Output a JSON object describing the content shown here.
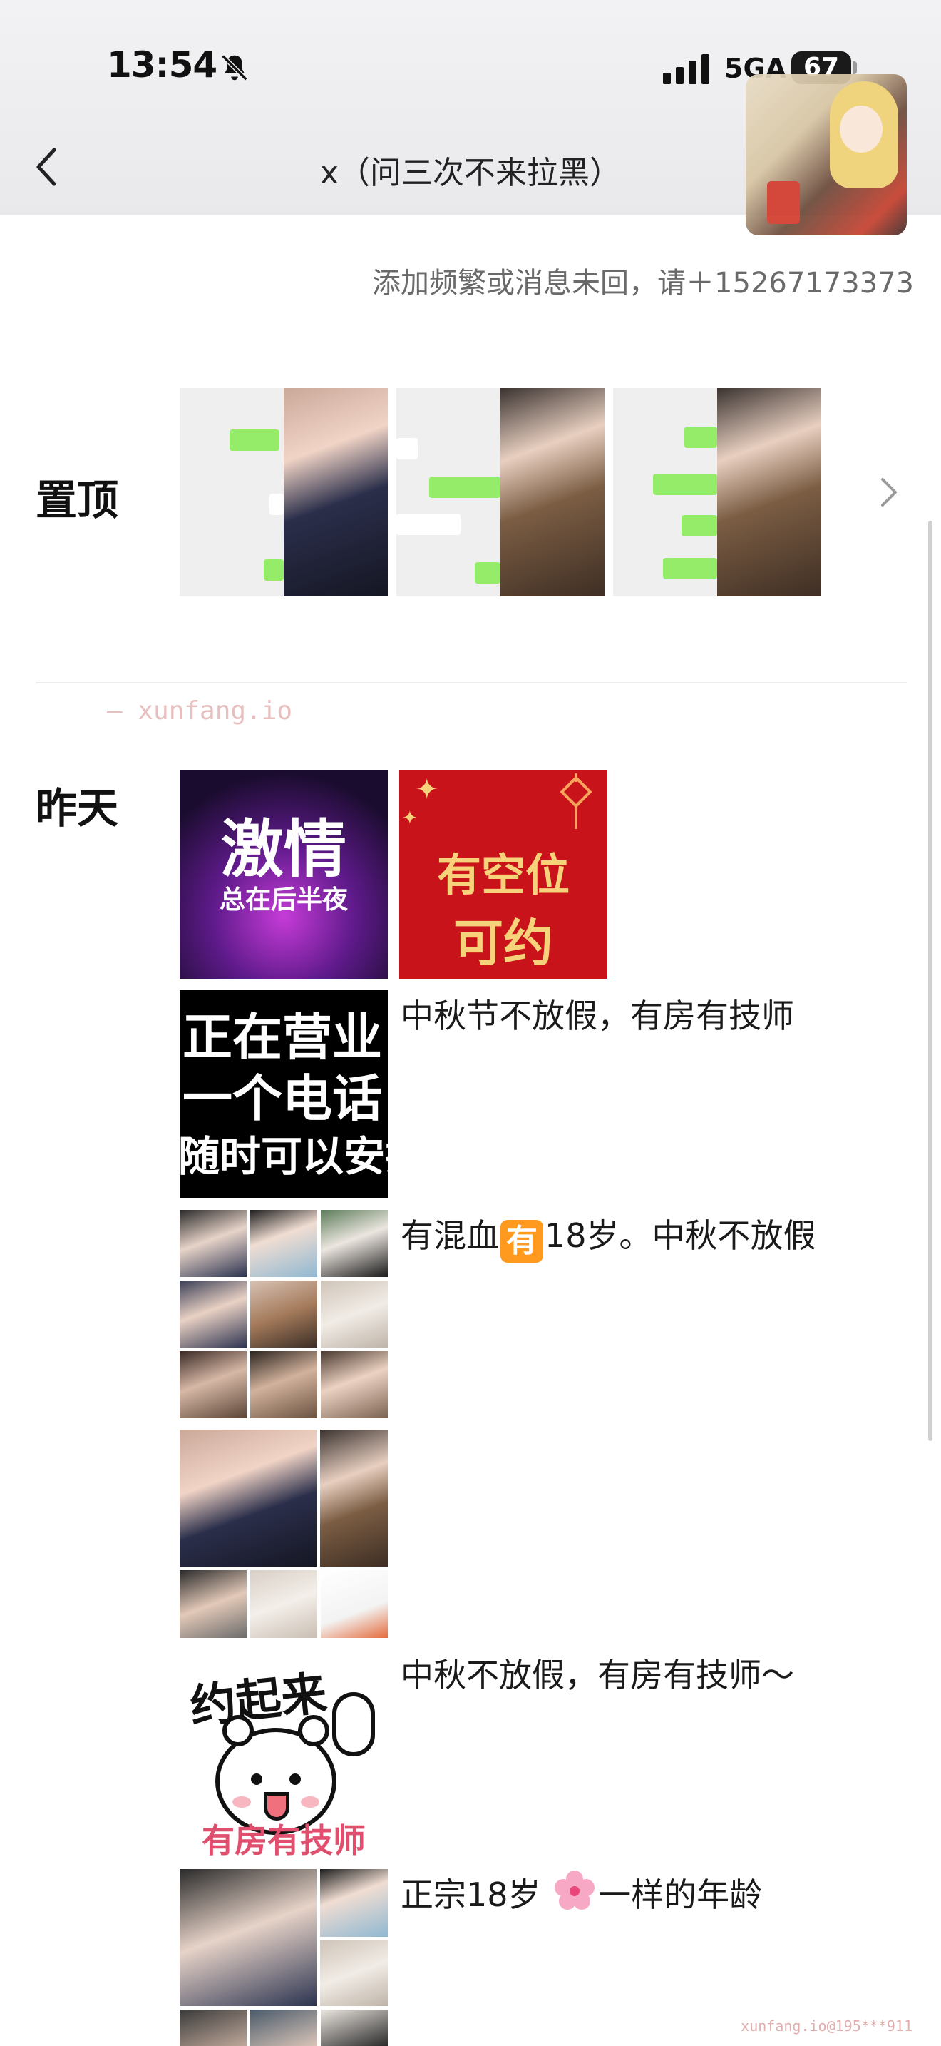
{
  "status_bar": {
    "time": "13:54",
    "network": "5GA",
    "battery": "67"
  },
  "nav": {
    "title": "x（问三次不来拉黑）"
  },
  "profile": {
    "signature": "添加频繁或消息未回，请＋15267173373"
  },
  "pinned": {
    "label": "置顶"
  },
  "yesterday": {
    "label": "昨天",
    "posts": [
      {
        "thumb_text": [
          "激情",
          "总在后半夜"
        ],
        "text": ""
      },
      {
        "thumb_text": [
          "有空位",
          "可约"
        ],
        "text": ""
      },
      {
        "thumb_text": [
          "正在营业",
          "一个电话",
          "随时可以安排"
        ],
        "text": "中秋节不放假，有房有技师"
      },
      {
        "text_before": "有混血",
        "emoji": "有",
        "text_after": "18岁。中秋不放假"
      },
      {
        "text": ""
      },
      {
        "thumb_text": [
          "约起来",
          "有房有技师"
        ],
        "text": "中秋不放假，有房有技师～"
      },
      {
        "text_before": "正宗18岁 ",
        "text_after": "一样的年龄"
      }
    ]
  },
  "watermarks": {
    "main": "— xunfang.io",
    "bottom": "xunfang.io@195***911"
  },
  "colors": {
    "accent_green": "#95ec69",
    "festival_red": "#c9131a",
    "gold_text": "#f6d27a"
  }
}
